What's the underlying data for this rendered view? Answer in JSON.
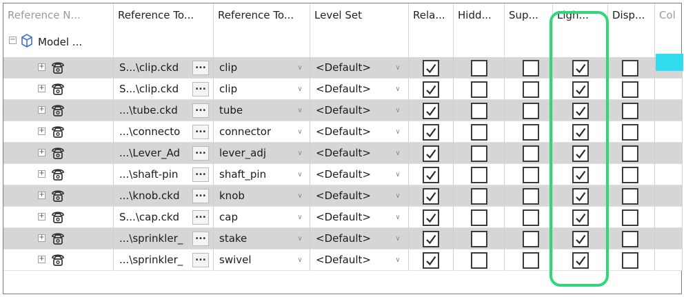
{
  "columns": [
    {
      "id": "ref_name",
      "label": "Reference N..."
    },
    {
      "id": "ref_to_file",
      "label": "Reference To..."
    },
    {
      "id": "ref_to_name",
      "label": "Reference To..."
    },
    {
      "id": "level_set",
      "label": "Level Set"
    },
    {
      "id": "relative",
      "label": "Rela..."
    },
    {
      "id": "hidden",
      "label": "Hidd..."
    },
    {
      "id": "suppressed",
      "label": "Sup..."
    },
    {
      "id": "lightweight",
      "label": "Ligh..."
    },
    {
      "id": "display",
      "label": "Disp..."
    },
    {
      "id": "color",
      "label": "Col"
    }
  ],
  "model": {
    "label": "Model ..."
  },
  "rows": [
    {
      "file": "S...\\clip.ckd",
      "name": "clip",
      "level": "<Default>",
      "relative": true,
      "hidden": false,
      "suppressed": false,
      "lightweight": true,
      "display": false
    },
    {
      "file": "S...\\clip.ckd",
      "name": "clip",
      "level": "<Default>",
      "relative": true,
      "hidden": false,
      "suppressed": false,
      "lightweight": true,
      "display": false
    },
    {
      "file": "...\\tube.ckd",
      "name": "tube",
      "level": "<Default>",
      "relative": true,
      "hidden": false,
      "suppressed": false,
      "lightweight": true,
      "display": false
    },
    {
      "file": "...\\connecto",
      "name": "connector",
      "level": "<Default>",
      "relative": true,
      "hidden": false,
      "suppressed": false,
      "lightweight": true,
      "display": false
    },
    {
      "file": "...\\Lever_Ad",
      "name": "lever_adj",
      "level": "<Default>",
      "relative": true,
      "hidden": false,
      "suppressed": false,
      "lightweight": true,
      "display": false
    },
    {
      "file": "...\\shaft-pin",
      "name": "shaft_pin",
      "level": "<Default>",
      "relative": true,
      "hidden": false,
      "suppressed": false,
      "lightweight": true,
      "display": false
    },
    {
      "file": "...\\knob.ckd",
      "name": "knob",
      "level": "<Default>",
      "relative": true,
      "hidden": false,
      "suppressed": false,
      "lightweight": true,
      "display": false
    },
    {
      "file": "S...\\cap.ckd",
      "name": "cap",
      "level": "<Default>",
      "relative": true,
      "hidden": false,
      "suppressed": false,
      "lightweight": true,
      "display": false
    },
    {
      "file": "...\\sprinkler_",
      "name": "stake",
      "level": "<Default>",
      "relative": true,
      "hidden": false,
      "suppressed": false,
      "lightweight": true,
      "display": false
    },
    {
      "file": "...\\sprinkler_",
      "name": "swivel",
      "level": "<Default>",
      "relative": true,
      "hidden": false,
      "suppressed": false,
      "lightweight": true,
      "display": false
    }
  ],
  "browse_label": "...",
  "colors": {
    "highlight": "#2fd67a",
    "row_shaded": "#d6d6d6",
    "selection_cyan": "#31dcef"
  }
}
